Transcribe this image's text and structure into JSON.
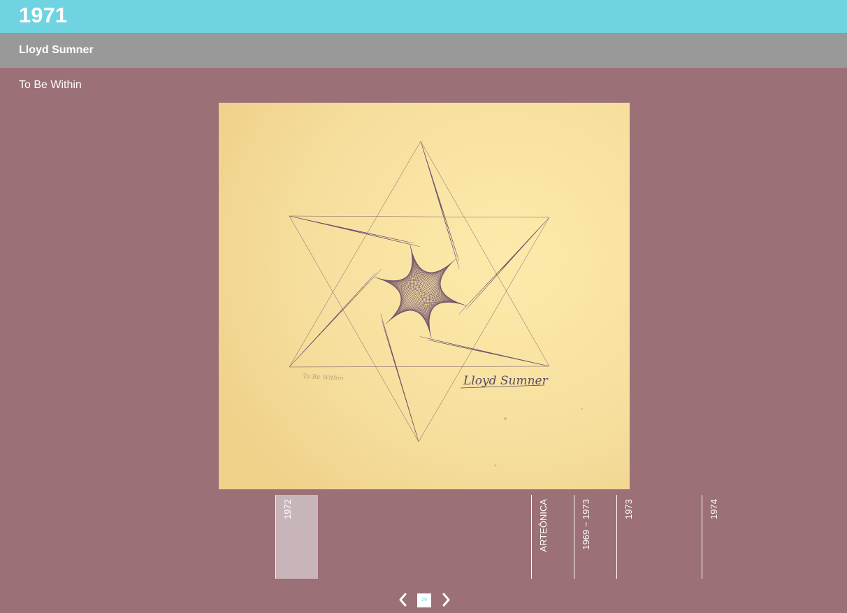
{
  "header": {
    "year": "1971"
  },
  "artist": {
    "name": "Lloyd Sumner"
  },
  "artwork": {
    "title": "To Be Within",
    "signature": "Lloyd Sumner",
    "inscription": "To Be Within"
  },
  "timeline": {
    "items": [
      {
        "label": "1972"
      },
      {
        "label": "ARTEÔNICA"
      },
      {
        "label": "1969 ~ 1973"
      },
      {
        "label": "1973"
      },
      {
        "label": "1974"
      }
    ]
  },
  "pager": {
    "current": "29",
    "prev_icon": "chevron-left-icon",
    "next_icon": "chevron-right-icon"
  },
  "colors": {
    "header": "#6fd3e1",
    "subheader": "#999999",
    "background": "#9b7077",
    "paper": "#f8e2a2",
    "ink": "#4a2a5a",
    "active_timeline": "#c8b5b9"
  }
}
